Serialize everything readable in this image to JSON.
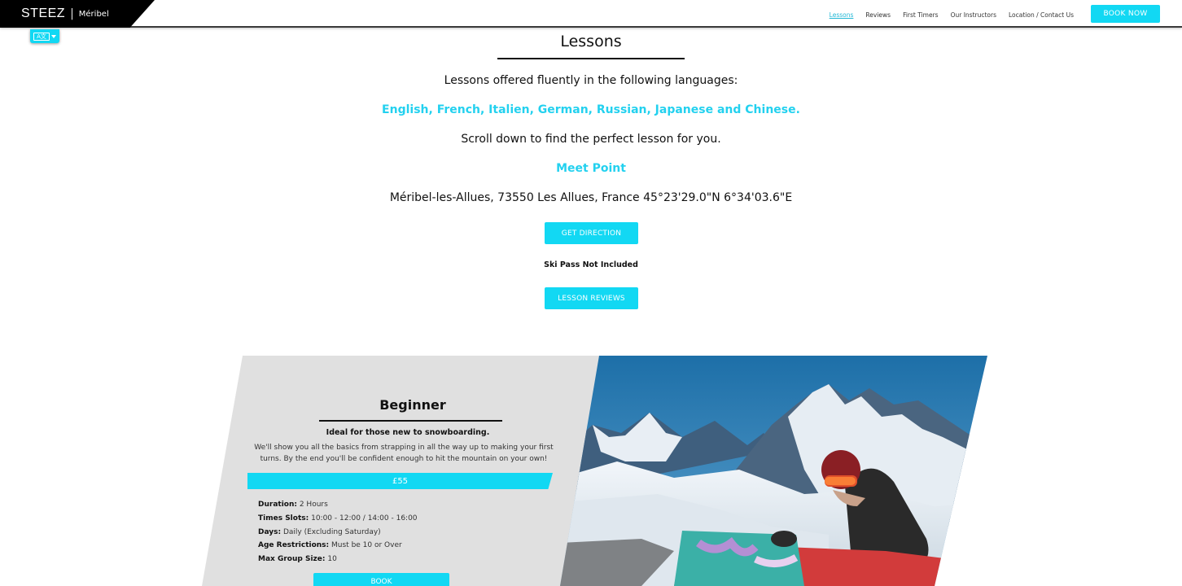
{
  "header": {
    "logo_brand": "STEEZ",
    "logo_separator": "|",
    "logo_town": "Méribel",
    "nav": [
      {
        "label": "Lessons",
        "active": true
      },
      {
        "label": "Reviews"
      },
      {
        "label": "First Timers"
      },
      {
        "label": "Our Instructors"
      },
      {
        "label": "Location / Contact Us"
      }
    ],
    "book_now": "BOOK NOW"
  },
  "language_toggle": {
    "icon": "translate-icon"
  },
  "intro": {
    "title": "Lessons",
    "languages_intro": "Lessons offered fluently in the following languages:",
    "languages": "English, French, Italien, German, Russian, Japanese and Chinese.",
    "scroll_hint": "Scroll down to find the perfect lesson for you.",
    "meet_point_heading": "Meet Point",
    "meet_point_address": "Méribel-les-Allues, 73550 Les Allues, France 45°23'29.0\"N 6°34'03.6\"E",
    "get_direction": "GET DIRECTION",
    "ski_pass_note": "Ski Pass Not Included",
    "lesson_reviews": "LESSON REVIEWS"
  },
  "lesson": {
    "title": "Beginner",
    "subtitle": "Ideal for those new to snowboarding.",
    "description": "We'll show you all the basics from strapping in all the way up to making your first turns. By the end you'll be confident enough to hit the mountain on your own!",
    "price": "£55",
    "details": [
      {
        "label": "Duration:",
        "value": "2 Hours"
      },
      {
        "label": "Times Slots:",
        "value": "10:00 - 12:00 / 14:00 - 16:00"
      },
      {
        "label": "Days:",
        "value": "Daily (Excluding Saturday)"
      },
      {
        "label": "Age Restrictions:",
        "value": "Must be 10 or Over"
      },
      {
        "label": "Max Group Size:",
        "value": "10"
      }
    ],
    "book_label": "BOOK"
  },
  "colors": {
    "accent": "#12d8f3",
    "accent_text": "#23d1ef",
    "card_bg": "#e0e0e0"
  }
}
